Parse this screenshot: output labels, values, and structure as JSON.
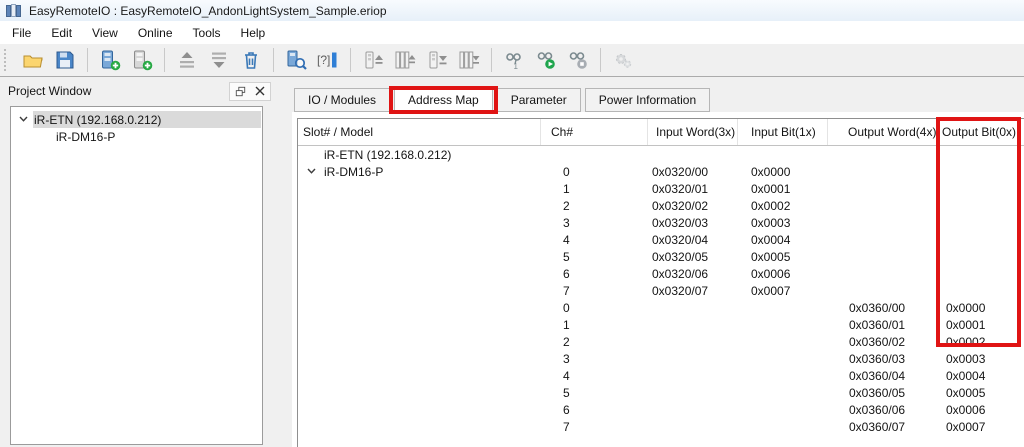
{
  "window": {
    "title": "EasyRemoteIO : EasyRemoteIO_AndonLightSystem_Sample.eriop"
  },
  "menu": {
    "items": [
      "File",
      "Edit",
      "View",
      "Online",
      "Tools",
      "Help"
    ]
  },
  "toolbar": {
    "buttons": [
      "open-project",
      "save-project",
      "add-module",
      "insert-module",
      "move-module-up",
      "move-module-down",
      "delete-module",
      "scan-modules",
      "io-address-config",
      "upload-module",
      "upload-all-modules",
      "download-module",
      "download-all-modules",
      "connect-device",
      "go-online",
      "go-offline",
      "settings-disabled"
    ]
  },
  "project_window": {
    "title": "Project Window",
    "tree": [
      {
        "label": "iR-ETN (192.168.0.212)",
        "level": 0,
        "expanded": true,
        "selected": true
      },
      {
        "label": "iR-DM16-P",
        "level": 1,
        "expanded": false,
        "selected": false
      }
    ]
  },
  "tabs": [
    {
      "label": "IO / Modules",
      "active": false,
      "annotated": false
    },
    {
      "label": "Address Map",
      "active": true,
      "annotated": true
    },
    {
      "label": "Parameter",
      "active": false,
      "annotated": false
    },
    {
      "label": "Power Information",
      "active": false,
      "annotated": false
    }
  ],
  "table": {
    "columns": [
      "Slot# / Model",
      "Ch#",
      "Input Word(3x)",
      "Input Bit(1x)",
      "Output Word(4x)",
      "Output Bit(0x)"
    ],
    "rows": [
      {
        "model": "iR-ETN (192.168.0.212)",
        "expanded": false,
        "ch": "",
        "input_word": "",
        "input_bit": "",
        "output_word": "",
        "output_bit": ""
      },
      {
        "model": "iR-DM16-P",
        "expanded": true,
        "ch": "0",
        "input_word": "0x0320/00",
        "input_bit": "0x0000",
        "output_word": "",
        "output_bit": ""
      },
      {
        "model": "",
        "ch": "1",
        "input_word": "0x0320/01",
        "input_bit": "0x0001",
        "output_word": "",
        "output_bit": ""
      },
      {
        "model": "",
        "ch": "2",
        "input_word": "0x0320/02",
        "input_bit": "0x0002",
        "output_word": "",
        "output_bit": ""
      },
      {
        "model": "",
        "ch": "3",
        "input_word": "0x0320/03",
        "input_bit": "0x0003",
        "output_word": "",
        "output_bit": ""
      },
      {
        "model": "",
        "ch": "4",
        "input_word": "0x0320/04",
        "input_bit": "0x0004",
        "output_word": "",
        "output_bit": ""
      },
      {
        "model": "",
        "ch": "5",
        "input_word": "0x0320/05",
        "input_bit": "0x0005",
        "output_word": "",
        "output_bit": ""
      },
      {
        "model": "",
        "ch": "6",
        "input_word": "0x0320/06",
        "input_bit": "0x0006",
        "output_word": "",
        "output_bit": ""
      },
      {
        "model": "",
        "ch": "7",
        "input_word": "0x0320/07",
        "input_bit": "0x0007",
        "output_word": "",
        "output_bit": ""
      },
      {
        "model": "",
        "ch": "0",
        "input_word": "",
        "input_bit": "",
        "output_word": "0x0360/00",
        "output_bit": "0x0000"
      },
      {
        "model": "",
        "ch": "1",
        "input_word": "",
        "input_bit": "",
        "output_word": "0x0360/01",
        "output_bit": "0x0001"
      },
      {
        "model": "",
        "ch": "2",
        "input_word": "",
        "input_bit": "",
        "output_word": "0x0360/02",
        "output_bit": "0x0002"
      },
      {
        "model": "",
        "ch": "3",
        "input_word": "",
        "input_bit": "",
        "output_word": "0x0360/03",
        "output_bit": "0x0003"
      },
      {
        "model": "",
        "ch": "4",
        "input_word": "",
        "input_bit": "",
        "output_word": "0x0360/04",
        "output_bit": "0x0004"
      },
      {
        "model": "",
        "ch": "5",
        "input_word": "",
        "input_bit": "",
        "output_word": "0x0360/05",
        "output_bit": "0x0005"
      },
      {
        "model": "",
        "ch": "6",
        "input_word": "",
        "input_bit": "",
        "output_word": "0x0360/06",
        "output_bit": "0x0006"
      },
      {
        "model": "",
        "ch": "7",
        "input_word": "",
        "input_bit": "",
        "output_word": "0x0360/07",
        "output_bit": "0x0007"
      }
    ]
  },
  "annotations": [
    {
      "name": "address-map-tab-highlight",
      "color": "#e01414"
    },
    {
      "name": "output-bit-column-highlight",
      "color": "#e01414"
    }
  ]
}
